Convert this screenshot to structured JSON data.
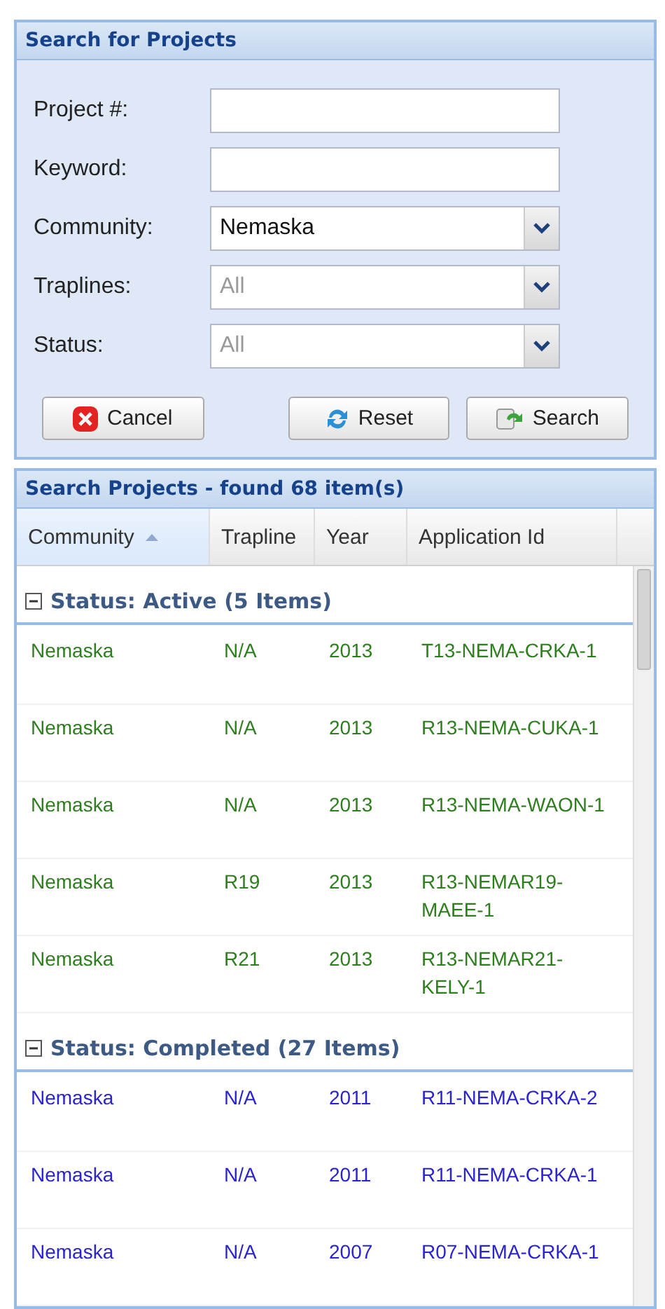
{
  "search_panel": {
    "title": "Search for Projects",
    "fields": [
      {
        "label": "Project #:",
        "kind": "text"
      },
      {
        "label": "Keyword:",
        "kind": "text"
      },
      {
        "label": "Community:",
        "kind": "combo",
        "value": "Nemaska"
      },
      {
        "label": "Traplines:",
        "kind": "combo",
        "placeholder": "All"
      },
      {
        "label": "Status:",
        "kind": "combo",
        "placeholder": "All"
      }
    ],
    "buttons": [
      {
        "label": "Cancel",
        "kind": "cancel"
      },
      {
        "label": "Reset",
        "kind": "reset"
      },
      {
        "label": "Search",
        "kind": "search"
      }
    ]
  },
  "results_panel": {
    "title": "Search Projects - found 68 item(s)",
    "columns": [
      {
        "label": "Community",
        "sorted": true
      },
      {
        "label": "Trapline",
        "sorted": false
      },
      {
        "label": "Year",
        "sorted": false
      },
      {
        "label": "Application Id",
        "sorted": false
      }
    ],
    "groups": [
      {
        "title": "Status: Active (5 Items)",
        "expanded": true,
        "color": "#2e7d1e",
        "rows": [
          [
            "Nemaska",
            "N/A",
            "2013",
            "T13-NEMA-CRKA-1"
          ],
          [
            "Nemaska",
            "N/A",
            "2013",
            "R13-NEMA-CUKA-1"
          ],
          [
            "Nemaska",
            "N/A",
            "2013",
            "R13-NEMA-WAON-1"
          ],
          [
            "Nemaska",
            "R19",
            "2013",
            "R13-NEMAR19-MAEE-1"
          ],
          [
            "Nemaska",
            "R21",
            "2013",
            "R13-NEMAR21-KELY-1"
          ]
        ]
      },
      {
        "title": "Status: Completed (27 Items)",
        "expanded": true,
        "color": "#2a23d0",
        "rows": [
          [
            "Nemaska",
            "N/A",
            "2011",
            "R11-NEMA-CRKA-2"
          ],
          [
            "Nemaska",
            "N/A",
            "2011",
            "R11-NEMA-CRKA-1"
          ],
          [
            "Nemaska",
            "N/A",
            "2007",
            "R07-NEMA-CRKA-1"
          ]
        ]
      }
    ]
  }
}
